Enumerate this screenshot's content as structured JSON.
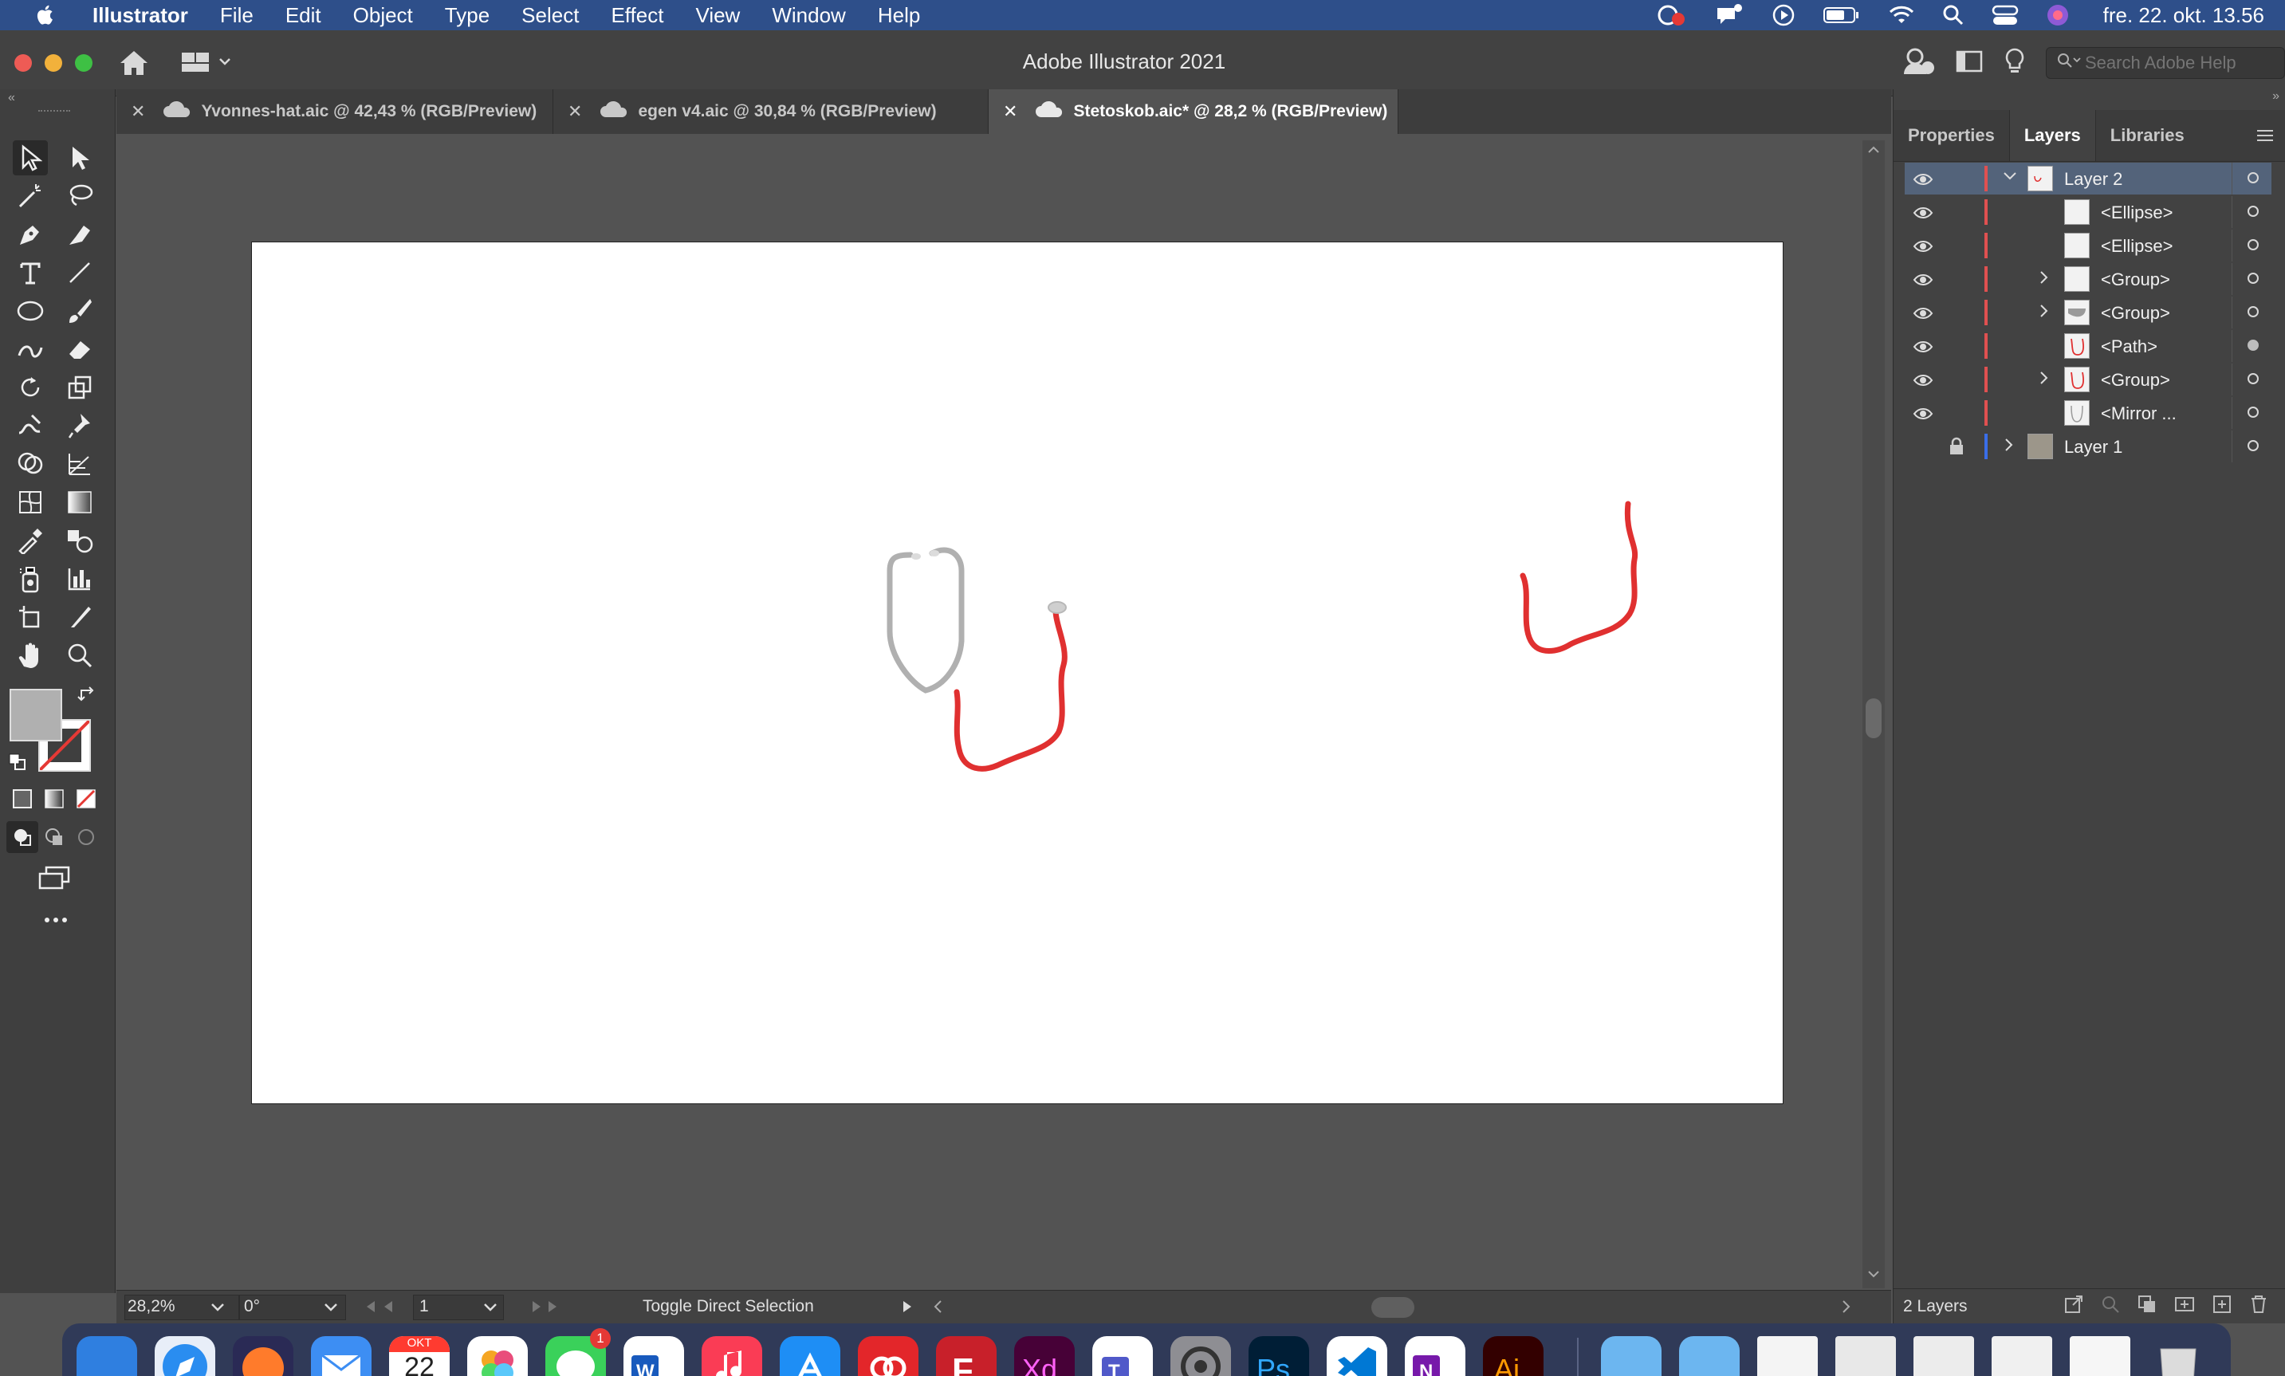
{
  "menubar": {
    "app_name": "Illustrator",
    "items": [
      "File",
      "Edit",
      "Object",
      "Type",
      "Select",
      "Effect",
      "View",
      "Window",
      "Help"
    ],
    "clock": "fre. 22. okt.  13.56"
  },
  "titlebar": {
    "title": "Adobe Illustrator 2021",
    "search_placeholder": "Search Adobe Help"
  },
  "tabs": [
    {
      "label": "Yvonnes-hat.aic @ 42,43 % (RGB/Preview)",
      "active": false
    },
    {
      "label": "egen v4.aic @ 30,84 % (RGB/Preview)",
      "active": false
    },
    {
      "label": "Stetoskob.aic* @ 28,2 % (RGB/Preview)",
      "active": true
    }
  ],
  "statusbar": {
    "zoom": "28,2%",
    "rotation": "0°",
    "artboard": "1",
    "tool_hint": "Toggle Direct Selection"
  },
  "panel": {
    "tabs": [
      "Properties",
      "Layers",
      "Libraries"
    ],
    "active_tab": "Layers",
    "footer_count": "2 Layers",
    "layers": [
      {
        "name": "Layer 2",
        "level": 0,
        "expanded": true,
        "selected": true,
        "color": "#e05050"
      },
      {
        "name": "<Ellipse>",
        "level": 1
      },
      {
        "name": "<Ellipse>",
        "level": 1
      },
      {
        "name": "<Group>",
        "level": 1,
        "has_children": true
      },
      {
        "name": "<Group>",
        "level": 1,
        "has_children": true
      },
      {
        "name": "<Path>",
        "level": 1,
        "target_filled": true
      },
      {
        "name": "<Group>",
        "level": 1,
        "has_children": true
      },
      {
        "name": "<Mirror ...",
        "level": 1
      },
      {
        "name": "Layer 1",
        "level": 0,
        "locked": true,
        "hidden": true,
        "has_children": true,
        "color": "#3a6ee8"
      }
    ]
  },
  "dock": {
    "messages_badge": "1",
    "calendar_month": "OKT",
    "calendar_day": "22"
  },
  "colors": {
    "menubar": "#2e4f8a",
    "ui_dark": "#424242",
    "canvas_bg": "#535353",
    "selection": "#53637a",
    "stethoscope_red": "#e03030",
    "stethoscope_gray": "#b0b0b0"
  }
}
